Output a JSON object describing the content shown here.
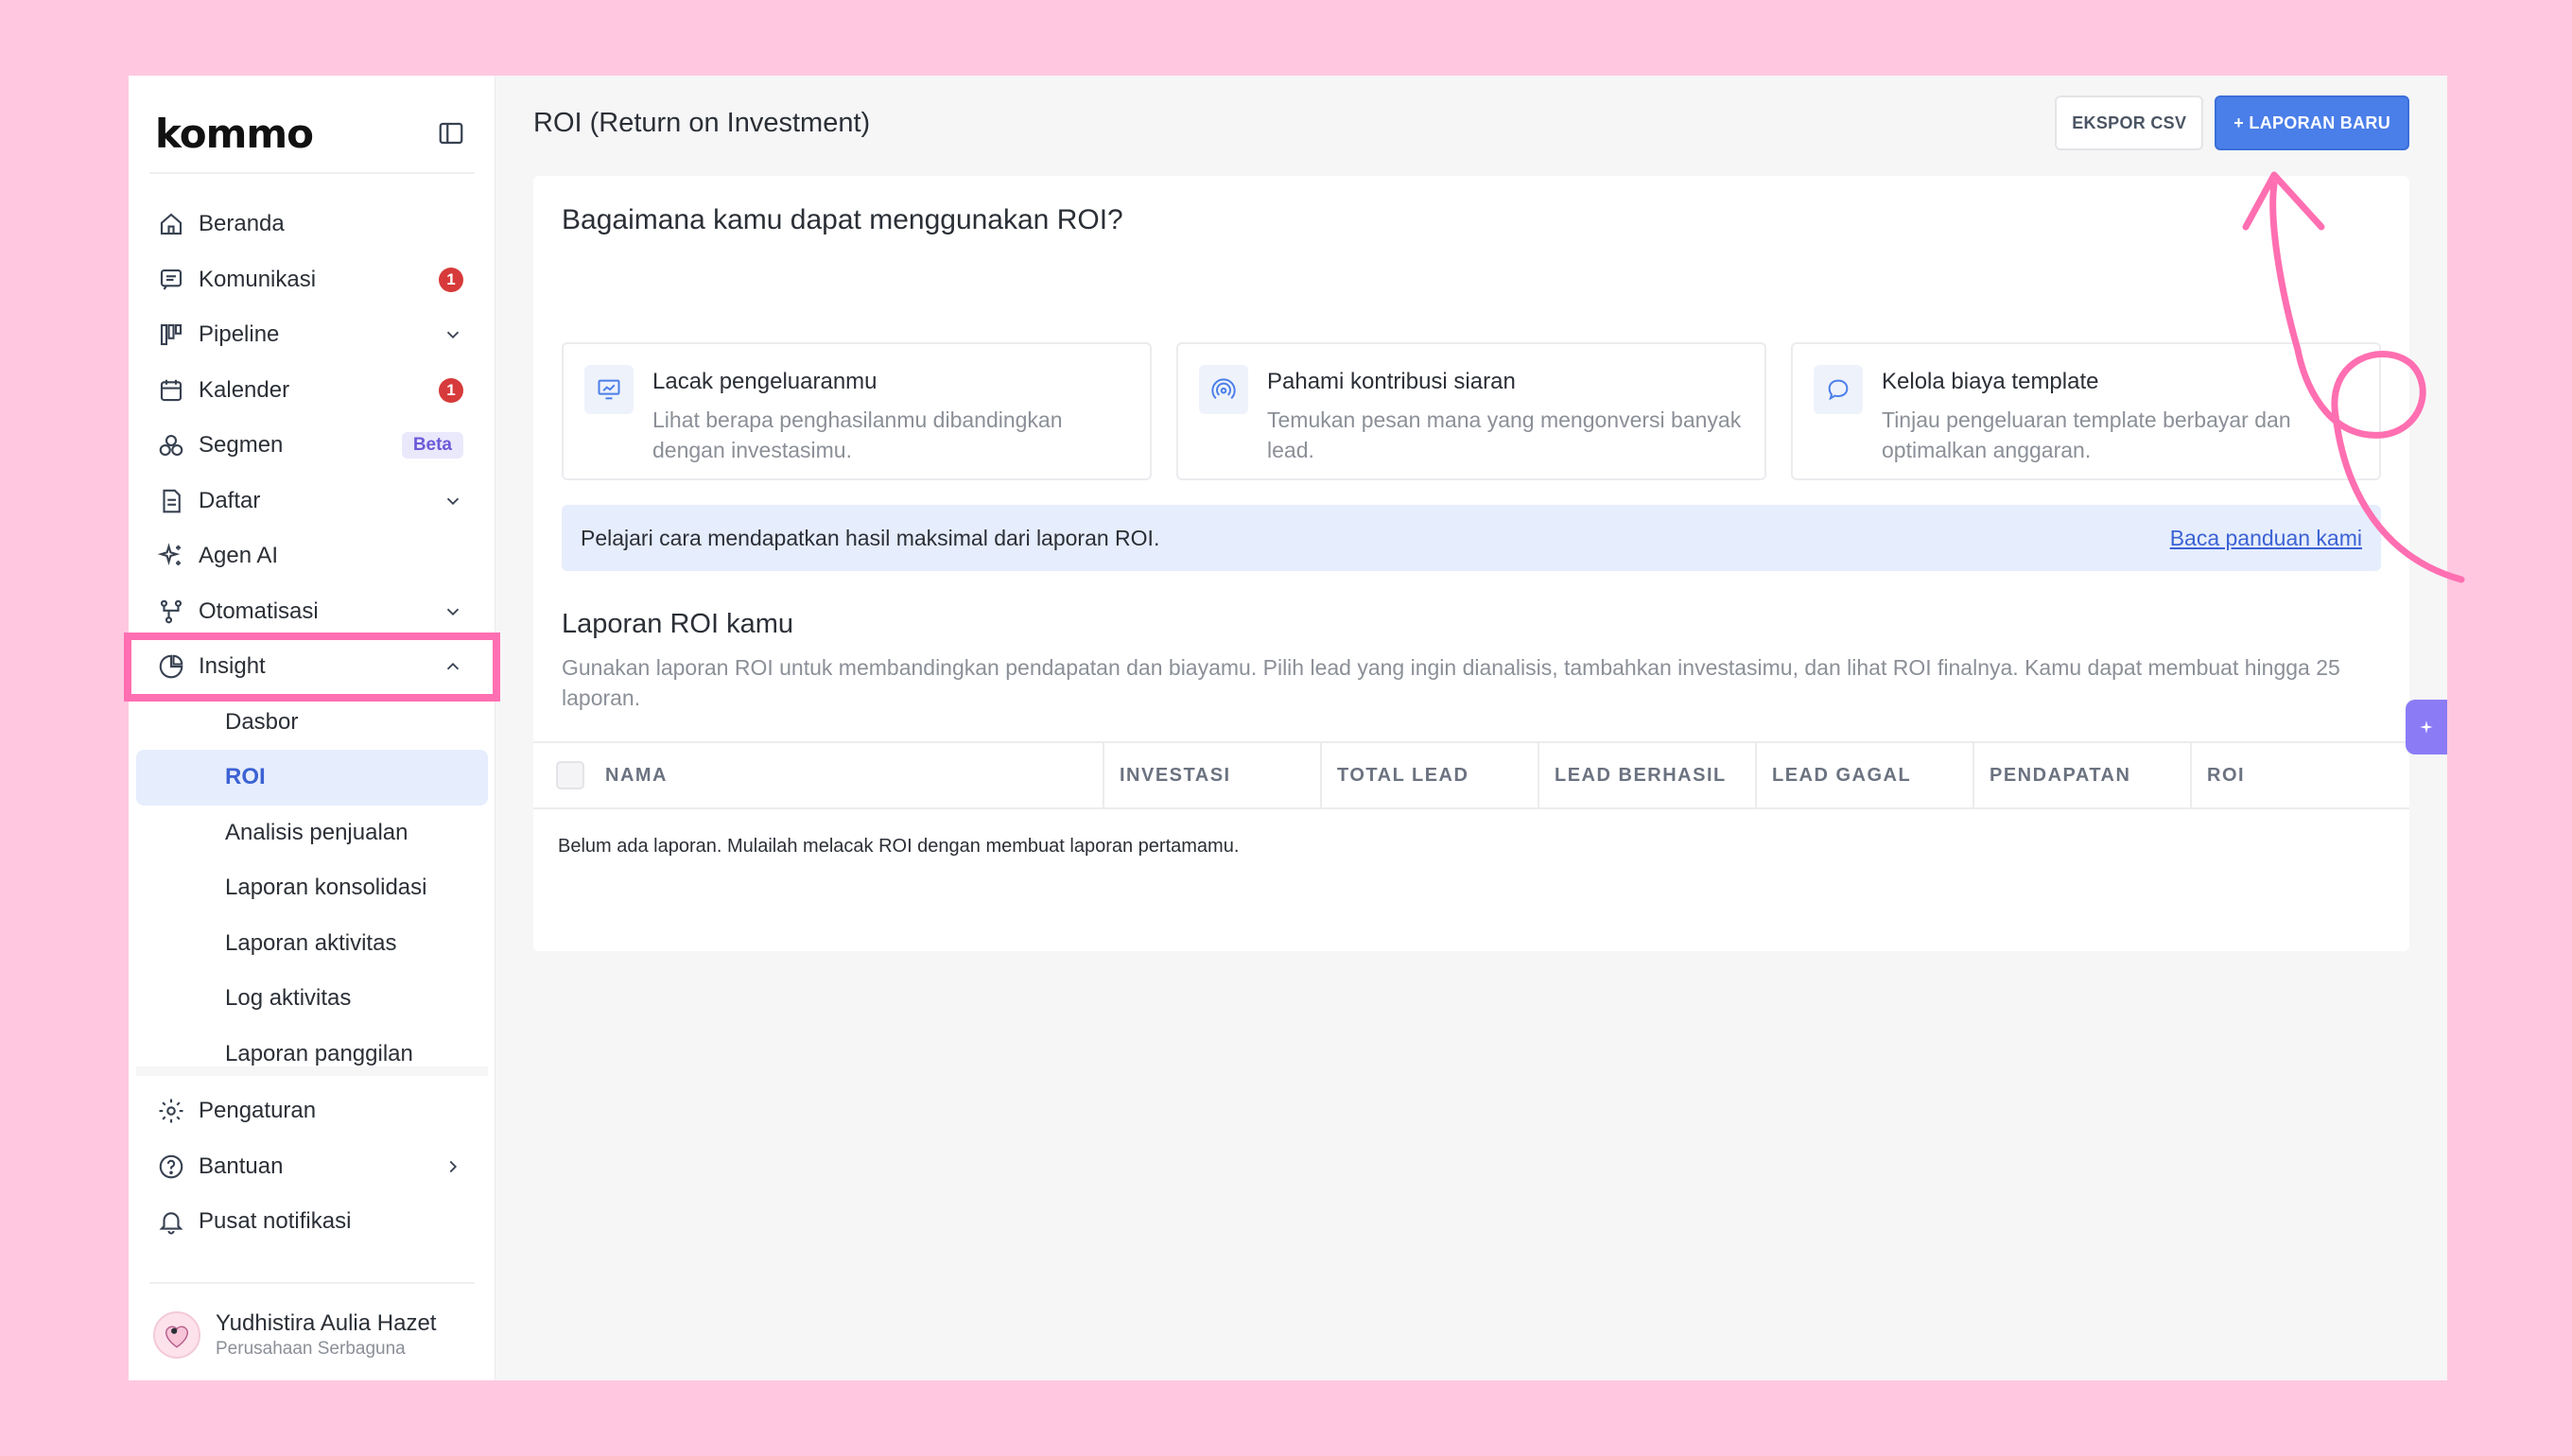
{
  "brand": {
    "logo_text": "kommo"
  },
  "sidebar": {
    "items": [
      {
        "label": "Beranda",
        "icon": "home-icon"
      },
      {
        "label": "Komunikasi",
        "icon": "chat-icon",
        "badge": "1"
      },
      {
        "label": "Pipeline",
        "icon": "pipeline-icon"
      },
      {
        "label": "Kalender",
        "icon": "calendar-icon",
        "badge": "1"
      },
      {
        "label": "Segmen",
        "icon": "segments-icon",
        "tag": "Beta"
      },
      {
        "label": "Daftar",
        "icon": "list-icon"
      },
      {
        "label": "Agen AI",
        "icon": "sparkles-icon"
      },
      {
        "label": "Otomatisasi",
        "icon": "automation-icon"
      },
      {
        "label": "Insight",
        "icon": "pie-chart-icon"
      }
    ],
    "sub_items": [
      "Dasbor",
      "ROI",
      "Analisis penjualan",
      "Laporan konsolidasi",
      "Laporan aktivitas",
      "Log aktivitas",
      "Laporan panggilan"
    ],
    "bottom_items": [
      {
        "label": "Pengaturan",
        "icon": "gear-icon"
      },
      {
        "label": "Bantuan",
        "icon": "help-icon"
      },
      {
        "label": "Pusat notifikasi",
        "icon": "bell-icon"
      }
    ],
    "profile": {
      "name": "Yudhistira Aulia Hazet",
      "company": "Perusahaan Serbaguna"
    }
  },
  "header": {
    "title": "ROI (Return on Investment)",
    "export_label": "EKSPOR CSV",
    "new_report_label": "+ LAPORAN BARU"
  },
  "how_to": {
    "title": "Bagaimana kamu dapat menggunakan ROI?",
    "features": [
      {
        "title": "Lacak pengeluaranmu",
        "desc": "Lihat berapa penghasilanmu dibandingkan dengan investasimu.",
        "icon": "monitor-chart-icon"
      },
      {
        "title": "Pahami kontribusi siaran",
        "desc": "Temukan pesan mana yang mengonversi banyak lead.",
        "icon": "broadcast-icon"
      },
      {
        "title": "Kelola biaya template",
        "desc": "Tinjau pengeluaran template berbayar dan optimalkan anggaran.",
        "icon": "chat-bubble-icon"
      }
    ],
    "info_text": "Pelajari cara mendapatkan hasil maksimal dari laporan ROI.",
    "info_link": "Baca panduan kami"
  },
  "reports": {
    "title": "Laporan ROI kamu",
    "subtitle": "Gunakan laporan ROI untuk membandingkan pendapatan dan biayamu. Pilih lead yang ingin dianalisis, tambahkan investasimu, dan lihat ROI finalnya. Kamu dapat membuat hingga 25 laporan.",
    "columns": [
      "NAMA",
      "INVESTASI",
      "TOTAL LEAD",
      "LEAD BERHASIL",
      "LEAD GAGAL",
      "PENDAPATAN",
      "ROI"
    ],
    "empty_text": "Belum ada laporan. Mulailah melacak ROI dengan membuat laporan pertamamu."
  },
  "colors": {
    "accent": "#4a7ee8",
    "highlight": "#ff6fb1",
    "background": "#ffc8e0"
  }
}
